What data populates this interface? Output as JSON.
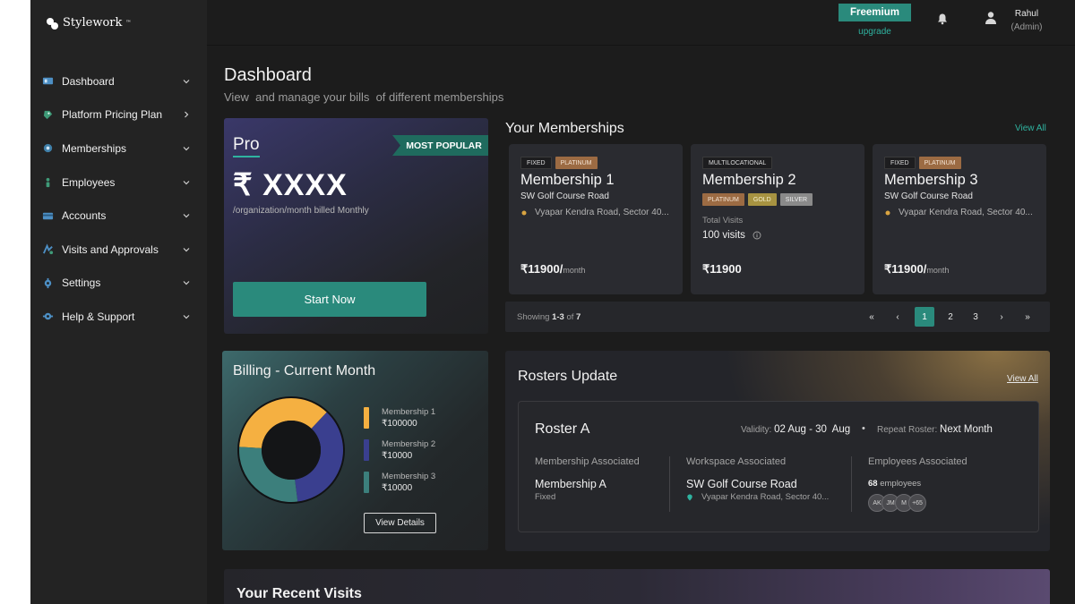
{
  "brand": {
    "name": "Stylework",
    "trademark": "™"
  },
  "sidebar": {
    "items": [
      {
        "label": "Dashboard",
        "icon": "dashboard-icon",
        "chevron": "down"
      },
      {
        "label": "Platform Pricing Plan",
        "icon": "pricing-icon",
        "chevron": "right"
      },
      {
        "label": "Memberships",
        "icon": "membership-icon",
        "chevron": "down"
      },
      {
        "label": "Employees",
        "icon": "employees-icon",
        "chevron": "down"
      },
      {
        "label": "Accounts",
        "icon": "accounts-icon",
        "chevron": "down"
      },
      {
        "label": "Visits and Approvals",
        "icon": "visits-icon",
        "chevron": "down"
      },
      {
        "label": "Settings",
        "icon": "settings-icon",
        "chevron": "down"
      },
      {
        "label": "Help & Support",
        "icon": "help-icon",
        "chevron": "down"
      }
    ]
  },
  "topbar": {
    "plan": "Freemium",
    "upgrade": "upgrade",
    "user_name": "Rahul",
    "user_role": "(Admin)"
  },
  "page": {
    "title": "Dashboard",
    "subtitle": "View  and manage your bills  of different memberships"
  },
  "pro_card": {
    "name": "Pro",
    "ribbon": "MOST POPULAR",
    "price": "₹ XXXX",
    "price_sub": "/organization/month billed Monthly",
    "cta": "Start Now"
  },
  "memberships": {
    "title": "Your Memberships",
    "view_all": "View All",
    "cards": [
      {
        "tags": [
          "FIXED",
          "PLATINUM"
        ],
        "name": "Membership 1",
        "location": "SW Golf Course Road",
        "address": "Vyapar Kendra Road, Sector 40...",
        "price": "₹11900/",
        "period": "month"
      },
      {
        "tags": [
          "MULTILOCATIONAL"
        ],
        "name": "Membership 2",
        "tiers": [
          "PLATINUM",
          "GOLD",
          "SILVER"
        ],
        "visits_label": "Total Visits",
        "visits_value": "100 visits",
        "price": "₹11900"
      },
      {
        "tags": [
          "FIXED",
          "PLATINUM"
        ],
        "name": "Membership 3",
        "location": "SW Golf Course Road",
        "address": "Vyapar Kendra Road, Sector 40...",
        "price": "₹11900/",
        "period": "month"
      }
    ],
    "pager": {
      "showing_prefix": "Showing",
      "range": "1-3",
      "of": "of",
      "total": "7",
      "first": "«",
      "prev": "‹",
      "pages": [
        "1",
        "2",
        "3"
      ],
      "active_page": "1",
      "next": "›",
      "last": "»"
    }
  },
  "billing": {
    "title": "Billing - Current Month",
    "items": [
      {
        "name": "Membership 1",
        "value": "₹100000",
        "color": "#f5b041"
      },
      {
        "name": "Membership 2",
        "value": "₹10000",
        "color": "#3a3f8f"
      },
      {
        "name": "Membership 3",
        "value": "₹10000",
        "color": "#3c7f7c"
      }
    ],
    "donut_fractions": [
      0.36,
      0.36,
      0.28
    ],
    "button": "View Details"
  },
  "rosters": {
    "title": "Rosters Update",
    "view_all": "View All",
    "roster": {
      "name": "Roster A",
      "validity_label": "Validity:",
      "validity": "02 Aug - 30  Aug",
      "separator": "•",
      "repeat_label": "Repeat Roster:",
      "repeat": "Next Month",
      "membership_label": "Membership Associated",
      "membership": "Membership A",
      "membership_type": "Fixed",
      "workspace_label": "Workspace Associated",
      "workspace": "SW Golf Course Road",
      "workspace_addr": "Vyapar Kendra Road, Sector 40...",
      "employees_label": "Employees Associated",
      "employees_count": "68",
      "employees_word": "employees",
      "avatars": [
        "AK",
        "JM",
        "M",
        "+65"
      ]
    }
  },
  "recent": {
    "title": "Your Recent Visits"
  },
  "colors": {
    "accent": "#2a8a7c",
    "accent_text": "#2fb3a0",
    "background": "#1c1c1c",
    "sidebar": "#232323"
  }
}
